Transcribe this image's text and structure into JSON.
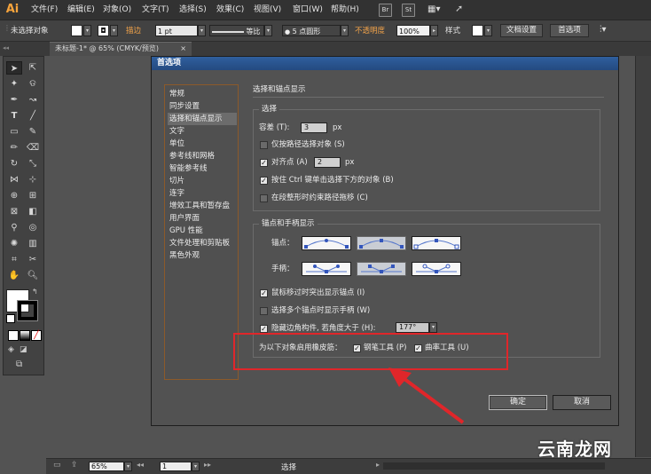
{
  "app": {
    "logo": "Ai"
  },
  "menubar": {
    "items": [
      "文件(F)",
      "编辑(E)",
      "对象(O)",
      "文字(T)",
      "选择(S)",
      "效果(C)",
      "视图(V)",
      "窗口(W)",
      "帮助(H)"
    ],
    "icons": {
      "bridge": "Br",
      "stock": "St"
    }
  },
  "controlbar": {
    "selection_status": "未选择对象",
    "stroke_label": "描边",
    "stroke_weight": "1 pt",
    "profile_value": "等比",
    "brush_value": "5 点圆形",
    "opacity_label": "不透明度",
    "opacity_value": "100%",
    "style_label": "样式",
    "doc_setup_button": "文档设置",
    "prefs_button": "首选项"
  },
  "document_tab": {
    "title": "未标题-1* @ 65% (CMYK/预览)",
    "close": "×"
  },
  "statusbar": {
    "zoom": "65%",
    "artboard": "1",
    "mode": "选择"
  },
  "dialog": {
    "title": "首选项",
    "categories": [
      "常规",
      "同步设置",
      "选择和锚点显示",
      "文字",
      "单位",
      "参考线和网格",
      "智能参考线",
      "切片",
      "连字",
      "增效工具和暂存盘",
      "用户界面",
      "GPU 性能",
      "文件处理和剪贴板",
      "黑色外观"
    ],
    "active_category_index": 2,
    "section_title": "选择和锚点显示",
    "selection_group": {
      "title": "选择",
      "tolerance_label": "容差 (T):",
      "tolerance_value": "3",
      "tolerance_unit": "px",
      "object_by_path": "仅按路径选择对象 (S)",
      "snap_to_point": "对齐点 (A)",
      "snap_value": "2",
      "snap_unit": "px",
      "ctrl_click": "按住 Ctrl 键单击选择下方的对象 (B)",
      "constrain_path": "在段整形时约束路径拖移 (C)"
    },
    "anchor_group": {
      "title": "锚点和手柄显示",
      "anchors_label": "锚点：",
      "handles_label": "手柄：",
      "highlight_anchors": "鼠标移过时突出显示锚点 (I)",
      "show_handles": "选择多个锚点时显示手柄 (W)",
      "hide_corner": "隐藏边角构件, 若角度大于 (H):",
      "corner_angle": "177°",
      "rubber_band_label": "为以下对象启用橡皮筋：",
      "pen_tool": "钢笔工具 (P)",
      "curvature_tool": "曲率工具 (U)"
    },
    "ok_button": "确定",
    "cancel_button": "取消"
  },
  "watermark": "云南龙网",
  "colors": {
    "annotation_red": "#e0262a",
    "title_bar": "#2f5f9e",
    "ai_logo": "#f7a43c"
  }
}
